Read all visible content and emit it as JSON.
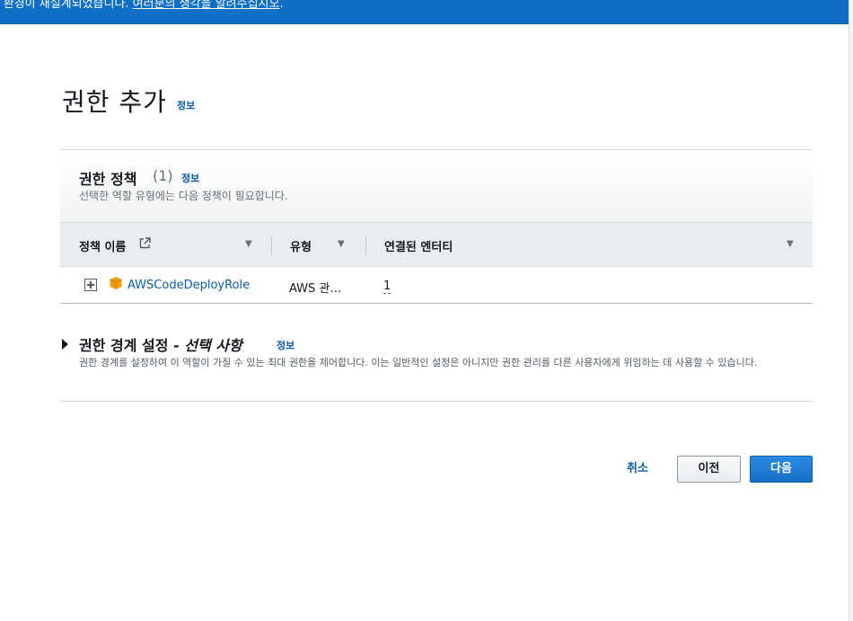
{
  "banner": {
    "text": "l 환경이 재설계되었습니다. ",
    "link": "여러분의 생각을 알려주십시오",
    "suffix": "."
  },
  "page": {
    "title": "권한 추가",
    "info": "정보"
  },
  "policies_panel": {
    "title": "권한 정책",
    "count": "(1)",
    "info": "정보",
    "description": "선택한 역할 유형에는 다음 정책이 필요합니다.",
    "columns": [
      "정책 이름",
      "유형",
      "연결된 엔터티"
    ],
    "rows": [
      {
        "name": "AWSCodeDeployRole",
        "type": "AWS 관…",
        "entities": "1"
      }
    ]
  },
  "boundary": {
    "title": "권한 경계 설정 - ",
    "title_optional": "선택 사항",
    "info": "정보",
    "description": "권한 경계를 설정하여 이 역할이 가질 수 있는 최대 권한을 제어합니다. 이는 일반적인 설정은 아니지만 권한 관리를 다른 사용자에게 위임하는 데 사용할 수 있습니다."
  },
  "footer": {
    "cancel": "취소",
    "previous": "이전",
    "next": "다음"
  },
  "icons": {
    "external_link": "external-link-icon",
    "expand": "plus-square-icon",
    "policy": "aws-cube-icon",
    "sort": "sort-caret-down-icon",
    "section_toggle": "caret-right-icon"
  },
  "colors": {
    "banner": "#0f6fc6",
    "link": "#0a5ca8",
    "primary_button": "#1a6fc8",
    "policy_icon": "#f59e0b"
  }
}
